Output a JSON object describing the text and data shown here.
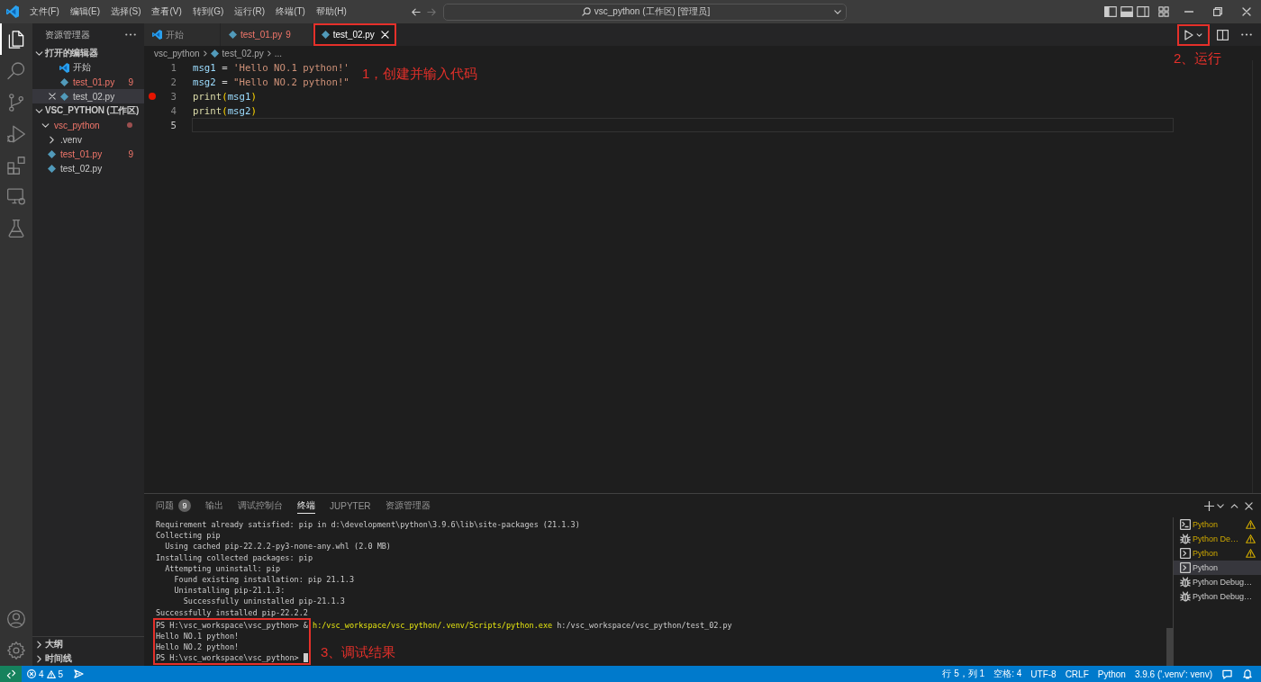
{
  "title_bar": {
    "menu": [
      "文件(F)",
      "编辑(E)",
      "选择(S)",
      "查看(V)",
      "转到(G)",
      "运行(R)",
      "终端(T)",
      "帮助(H)"
    ],
    "nav": [
      {
        "kind": "back",
        "disabled": false
      },
      {
        "kind": "forward",
        "disabled": true
      }
    ],
    "command_center": "vsc_python (工作区) [管理员]"
  },
  "activity_bar": {
    "items": [
      {
        "kind": "explorer",
        "selected": true
      },
      {
        "kind": "search",
        "selected": false
      },
      {
        "kind": "source_control",
        "selected": false
      },
      {
        "kind": "run_debug",
        "selected": false
      },
      {
        "kind": "extensions",
        "selected": false
      },
      {
        "kind": "remote_explorer",
        "selected": false
      },
      {
        "kind": "testing",
        "selected": false
      }
    ]
  },
  "sidebar": {
    "title": "资源管理器",
    "open_editors": {
      "title": "打开的编辑器",
      "expanded": true,
      "items": [
        {
          "label": "开始",
          "kind": "welcome",
          "error": false,
          "selected": false
        },
        {
          "label": "test_01.py",
          "kind": "python",
          "error": true,
          "problems": "9",
          "selected": false
        },
        {
          "label": "test_02.py",
          "kind": "python",
          "error": false,
          "selected": true
        }
      ]
    },
    "workspace": {
      "title": "VSC_PYTHON (工作区)",
      "expanded": true,
      "items": [
        {
          "label": "vsc_python",
          "kind": "folder",
          "expanded": true,
          "error": true,
          "contains_errors": true,
          "selected": false,
          "children": [
            {
              "label": ".venv",
              "kind": "folder",
              "expanded": false,
              "error": false,
              "contains_errors": false,
              "selected": false
            },
            {
              "label": "test_01.py",
              "kind": "python",
              "error": true,
              "problems": "9",
              "selected": false
            },
            {
              "label": "test_02.py",
              "kind": "python",
              "error": false,
              "selected": false
            }
          ]
        }
      ]
    },
    "outline": {
      "title": "大纲",
      "expanded": false
    },
    "timeline": {
      "title": "时间线",
      "expanded": false
    }
  },
  "editor": {
    "tabs": [
      {
        "label": "开始",
        "kind": "welcome",
        "error": false,
        "selected": false,
        "annotated": false
      },
      {
        "label": "test_01.py",
        "kind": "python",
        "error": true,
        "problems": "9",
        "selected": false,
        "annotated": false
      },
      {
        "label": "test_02.py",
        "kind": "python",
        "error": false,
        "selected": true,
        "annotated": true
      }
    ],
    "actions": [
      {
        "kind": "run",
        "annotated": true
      },
      {
        "kind": "split",
        "annotated": false
      },
      {
        "kind": "more",
        "annotated": false
      }
    ],
    "breadcrumb": [
      {
        "label": "vsc_python",
        "kind": "folder"
      },
      {
        "label": "test_02.py",
        "kind": "python"
      },
      {
        "label": "...",
        "kind": "symbol"
      }
    ],
    "lines": [
      {
        "number": "1",
        "breakpoint": false,
        "current": false,
        "tokens": [
          {
            "text": "msg1",
            "kind": "variable"
          },
          {
            "text": " = ",
            "kind": "operator"
          },
          {
            "text": "'Hello NO.1 python!'",
            "kind": "string"
          }
        ]
      },
      {
        "number": "2",
        "breakpoint": false,
        "current": false,
        "tokens": [
          {
            "text": "msg2",
            "kind": "variable"
          },
          {
            "text": " = ",
            "kind": "operator"
          },
          {
            "text": "\"Hello NO.2 python!\"",
            "kind": "string"
          }
        ]
      },
      {
        "number": "3",
        "breakpoint": true,
        "current": false,
        "tokens": [
          {
            "text": "print",
            "kind": "function"
          },
          {
            "text": "(",
            "kind": "bracket"
          },
          {
            "text": "msg1",
            "kind": "variable"
          },
          {
            "text": ")",
            "kind": "bracket"
          }
        ]
      },
      {
        "number": "4",
        "breakpoint": false,
        "current": false,
        "tokens": [
          {
            "text": "print",
            "kind": "function"
          },
          {
            "text": "(",
            "kind": "bracket"
          },
          {
            "text": "msg2",
            "kind": "variable"
          },
          {
            "text": ")",
            "kind": "bracket"
          }
        ]
      },
      {
        "number": "5",
        "breakpoint": false,
        "current": true
      }
    ],
    "code_annotation": "1，创建并输入代码",
    "run_annotation": "2、运行"
  },
  "panel": {
    "tabs": [
      {
        "label": "问题",
        "badge": "9",
        "selected": false
      },
      {
        "label": "输出",
        "selected": false
      },
      {
        "label": "调试控制台",
        "selected": false
      },
      {
        "label": "终端",
        "selected": true
      },
      {
        "label": "JUPYTER",
        "selected": false
      },
      {
        "label": "资源管理器",
        "selected": false
      }
    ],
    "terminal": {
      "lines": [
        {
          "text": "Requirement already satisfied: pip in d:\\development\\python\\3.9.6\\lib\\site-packages (21.1.3)",
          "annotated": false,
          "cursor": false
        },
        {
          "text": "Collecting pip",
          "annotated": false,
          "cursor": false
        },
        {
          "text": "  Using cached pip-22.2.2-py3-none-any.whl (2.0 MB)",
          "annotated": false,
          "cursor": false
        },
        {
          "text": "Installing collected packages: pip",
          "annotated": false,
          "cursor": false
        },
        {
          "text": "  Attempting uninstall: pip",
          "annotated": false,
          "cursor": false
        },
        {
          "text": "    Found existing installation: pip 21.1.3",
          "annotated": false,
          "cursor": false
        },
        {
          "text": "    Uninstalling pip-21.1.3:",
          "annotated": false,
          "cursor": false
        },
        {
          "text": "      Successfully uninstalled pip-21.1.3",
          "annotated": false,
          "cursor": false
        },
        {
          "text": "Successfully installed pip-22.2.2",
          "annotated": false,
          "cursor": false
        },
        {
          "segments": [
            {
              "text": "PS H:\\vsc_workspace\\vsc_python> &",
              "kind": "plain"
            },
            {
              "text": "h:/vsc_workspace/vsc_python/.venv/Scripts/python.exe",
              "kind": "command"
            },
            {
              "text": "h:/vsc_workspace/vsc_python/test_02.py",
              "kind": "plain"
            }
          ],
          "annotated": true,
          "cursor": false
        },
        {
          "text": "Hello NO.1 python!",
          "annotated": true,
          "cursor": false
        },
        {
          "text": "Hello NO.2 python!",
          "annotated": true,
          "cursor": false
        },
        {
          "text": "PS H:\\vsc_workspace\\vsc_python>",
          "annotated": true,
          "cursor": true
        }
      ],
      "annotation": "3、调试结果"
    },
    "terminals": [
      {
        "label": "Python",
        "kind": "shell",
        "warning": true,
        "selected": false
      },
      {
        "label": "Python De…",
        "kind": "debug",
        "warning": true,
        "selected": false
      },
      {
        "label": "Python",
        "kind": "terminal",
        "warning": true,
        "selected": false
      },
      {
        "label": "Python",
        "kind": "terminal",
        "warning": false,
        "selected": true
      },
      {
        "label": "Python Debug…",
        "kind": "debug",
        "warning": false,
        "selected": false
      },
      {
        "label": "Python Debug…",
        "kind": "debug",
        "warning": false,
        "selected": false
      }
    ]
  },
  "status_bar": {
    "errors": "4",
    "warnings": "5",
    "items": [
      "行 5，列 1",
      "空格: 4",
      "UTF-8",
      "CRLF",
      "Python",
      "3.9.6 ('.venv': venv)"
    ]
  }
}
